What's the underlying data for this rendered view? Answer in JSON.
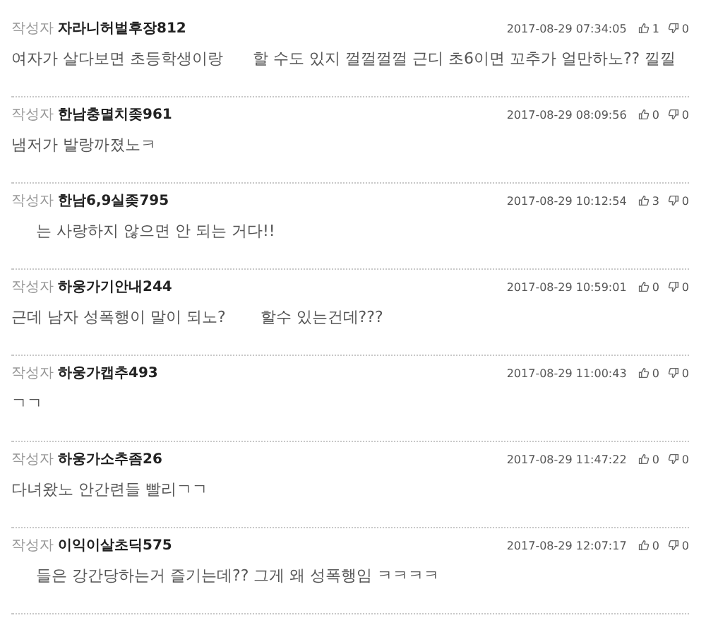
{
  "comments": [
    {
      "label": "작성자",
      "author": "자라니허벌후장812",
      "time": "2017-08-29 07:34:05",
      "likes": "1",
      "dislikes": "0",
      "body": "여자가 살다보면 초등학생이랑      할 수도 있지 껄껄껄껄 근디 초6이면 꼬추가 얼만하노?? 낄낄"
    },
    {
      "label": "작성자",
      "author": "한남충멸치좆961",
      "time": "2017-08-29 08:09:56",
      "likes": "0",
      "dislikes": "0",
      "body": "냄저가 발랑까졌노ㅋ"
    },
    {
      "label": "작성자",
      "author": "한남6,9실좆795",
      "time": "2017-08-29 10:12:54",
      "likes": "3",
      "dislikes": "0",
      "body": "     는 사랑하지 않으면 안 되는 거다!!"
    },
    {
      "label": "작성자",
      "author": "하웅가기안내244",
      "time": "2017-08-29 10:59:01",
      "likes": "0",
      "dislikes": "0",
      "body": "근데 남자 성폭행이 말이 되노?       할수 있는건데???"
    },
    {
      "label": "작성자",
      "author": "하웅가캡추493",
      "time": "2017-08-29 11:00:43",
      "likes": "0",
      "dislikes": "0",
      "body": "ㄱㄱ"
    },
    {
      "label": "작성자",
      "author": "하웅가소추좀26",
      "time": "2017-08-29 11:47:22",
      "likes": "0",
      "dislikes": "0",
      "body": "다녀왔노 안간련들 빨리ㄱㄱ"
    },
    {
      "label": "작성자",
      "author": "이익이살초딕575",
      "time": "2017-08-29 12:07:17",
      "likes": "0",
      "dislikes": "0",
      "body": "     들은 강간당하는거 즐기는데?? 그게 왜 성폭행임 ㅋㅋㅋㅋ"
    }
  ]
}
